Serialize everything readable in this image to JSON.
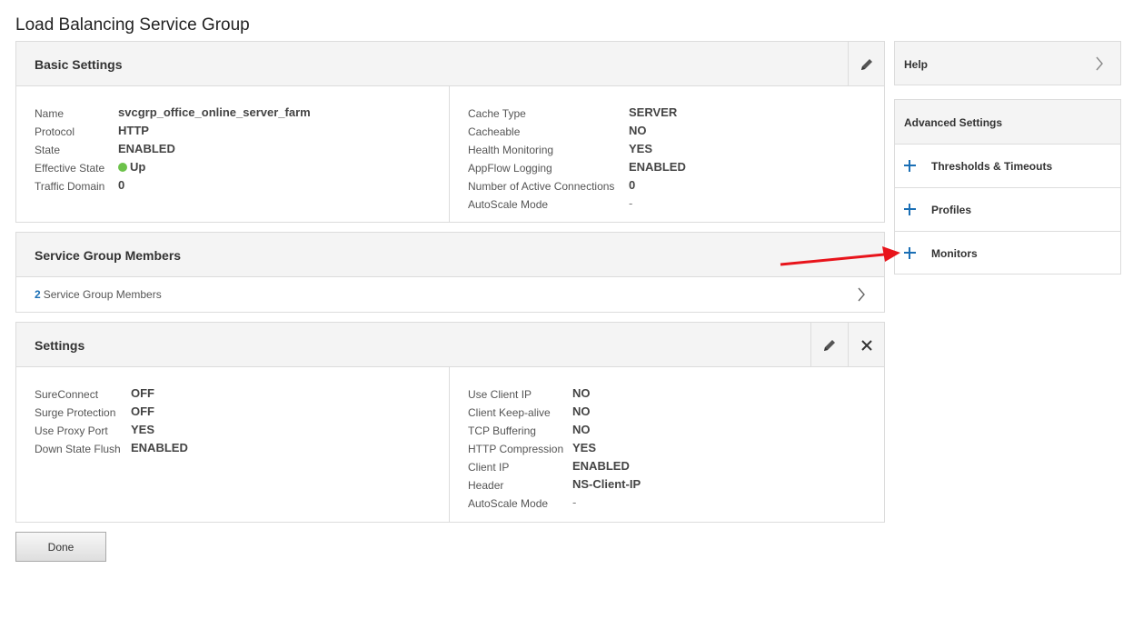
{
  "page_title": "Load Balancing Service Group",
  "basic_settings": {
    "title": "Basic Settings",
    "left": [
      {
        "label": "Name",
        "value": "svcgrp_office_online_server_farm"
      },
      {
        "label": "Protocol",
        "value": "HTTP"
      },
      {
        "label": "State",
        "value": "ENABLED"
      },
      {
        "label": "Effective State",
        "value": "Up"
      },
      {
        "label": "Traffic Domain",
        "value": "0"
      }
    ],
    "right": [
      {
        "label": "Cache Type",
        "value": "SERVER"
      },
      {
        "label": "Cacheable",
        "value": "NO"
      },
      {
        "label": "Health Monitoring",
        "value": "YES"
      },
      {
        "label": "AppFlow Logging",
        "value": "ENABLED"
      },
      {
        "label": "Number of Active Connections",
        "value": "0"
      },
      {
        "label": "AutoScale Mode",
        "value": "-"
      }
    ]
  },
  "members": {
    "title": "Service Group Members",
    "count": "2",
    "count_label": "Service Group Members"
  },
  "settings": {
    "title": "Settings",
    "left": [
      {
        "label": "SureConnect",
        "value": "OFF"
      },
      {
        "label": "Surge Protection",
        "value": "OFF"
      },
      {
        "label": "Use Proxy Port",
        "value": "YES"
      },
      {
        "label": "Down State Flush",
        "value": "ENABLED"
      }
    ],
    "right": [
      {
        "label": "Use Client IP",
        "value": "NO"
      },
      {
        "label": "Client Keep-alive",
        "value": "NO"
      },
      {
        "label": "TCP Buffering",
        "value": "NO"
      },
      {
        "label": "HTTP Compression",
        "value": "YES"
      },
      {
        "label": "Client IP",
        "value": "ENABLED"
      },
      {
        "label": "Header",
        "value": "NS-Client-IP"
      },
      {
        "label": "AutoScale Mode",
        "value": "-"
      }
    ]
  },
  "done_label": "Done",
  "help_label": "Help",
  "advanced": {
    "title": "Advanced Settings",
    "items": [
      {
        "label": "Thresholds & Timeouts"
      },
      {
        "label": "Profiles"
      },
      {
        "label": "Monitors"
      }
    ]
  },
  "colors": {
    "accent": "#1a6fb5",
    "status_up": "#6cc24a",
    "annotation_arrow": "#e8141b"
  },
  "icons": [
    "pencil-icon",
    "close-icon",
    "chevron-right-icon",
    "plus-icon",
    "status-dot-icon",
    "annotation-arrow"
  ]
}
